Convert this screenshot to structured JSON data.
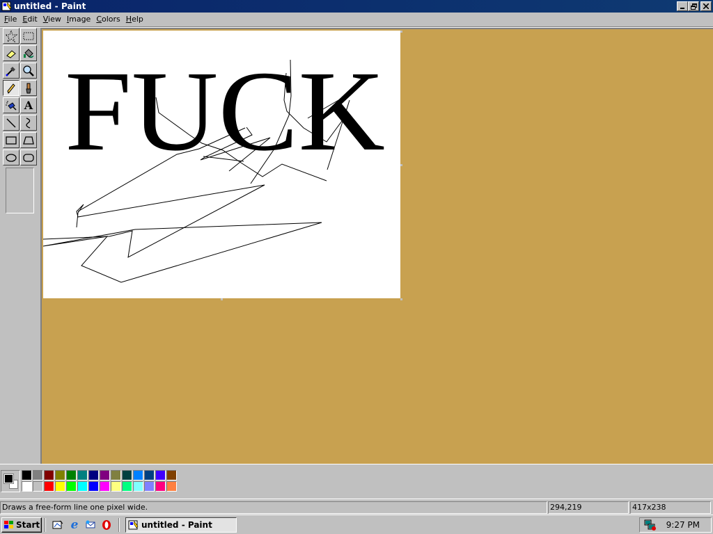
{
  "window": {
    "title": "untitled - Paint",
    "icon": "paint-app-icon",
    "caption_buttons": [
      "minimize-icon",
      "restore-icon",
      "close-icon"
    ]
  },
  "menu": {
    "items": [
      {
        "label": "File",
        "accel": "F",
        "rest": "ile"
      },
      {
        "label": "Edit",
        "accel": "E",
        "rest": "dit"
      },
      {
        "label": "View",
        "accel": "V",
        "rest": "iew"
      },
      {
        "label": "Image",
        "accel": "I",
        "rest": "mage"
      },
      {
        "label": "Colors",
        "accel": "C",
        "rest": "olors"
      },
      {
        "label": "Help",
        "accel": "H",
        "rest": "elp"
      }
    ]
  },
  "toolbox": {
    "tools": [
      {
        "name": "free-form-select",
        "icon": "star-select-icon"
      },
      {
        "name": "select",
        "icon": "rect-select-icon"
      },
      {
        "name": "eraser",
        "icon": "eraser-icon"
      },
      {
        "name": "fill-with-color",
        "icon": "paint-bucket-icon"
      },
      {
        "name": "pick-color",
        "icon": "eyedropper-icon"
      },
      {
        "name": "magnifier",
        "icon": "magnifier-icon"
      },
      {
        "name": "pencil",
        "icon": "pencil-icon",
        "active": true
      },
      {
        "name": "brush",
        "icon": "brush-icon"
      },
      {
        "name": "airbrush",
        "icon": "airbrush-icon"
      },
      {
        "name": "text",
        "icon": "text-icon",
        "glyph": "A"
      },
      {
        "name": "line",
        "icon": "line-icon"
      },
      {
        "name": "curve",
        "icon": "curve-icon"
      },
      {
        "name": "rectangle",
        "icon": "rectangle-icon"
      },
      {
        "name": "polygon",
        "icon": "polygon-icon"
      },
      {
        "name": "ellipse",
        "icon": "ellipse-icon"
      },
      {
        "name": "rounded-rectangle",
        "icon": "rounded-rectangle-icon"
      }
    ]
  },
  "canvas": {
    "text": "FUCK",
    "background": "#ffffff",
    "workspace_color": "#c8a150"
  },
  "palette": {
    "foreground": "#000000",
    "background": "#ffffff",
    "top_row": [
      "#000000",
      "#808080",
      "#800000",
      "#808000",
      "#008000",
      "#008080",
      "#000080",
      "#800080",
      "#808040",
      "#004040",
      "#0080ff",
      "#004080",
      "#4000ff",
      "#804000"
    ],
    "bottom_row": [
      "#ffffff",
      "#c0c0c0",
      "#ff0000",
      "#ffff00",
      "#00ff00",
      "#00ffff",
      "#0000ff",
      "#ff00ff",
      "#ffff80",
      "#00ff80",
      "#80ffff",
      "#8080ff",
      "#ff0080",
      "#ff8040"
    ]
  },
  "status": {
    "help_text": "Draws a free-form line one pixel wide.",
    "cursor_pos": "294,219",
    "canvas_size": "417x238"
  },
  "taskbar": {
    "start_label": "Start",
    "quick_launch": [
      "show-desktop-icon",
      "internet-explorer-icon",
      "outlook-express-icon",
      "opera-icon"
    ],
    "task_button_label": "untitled - Paint",
    "clock": "9:27 PM"
  }
}
